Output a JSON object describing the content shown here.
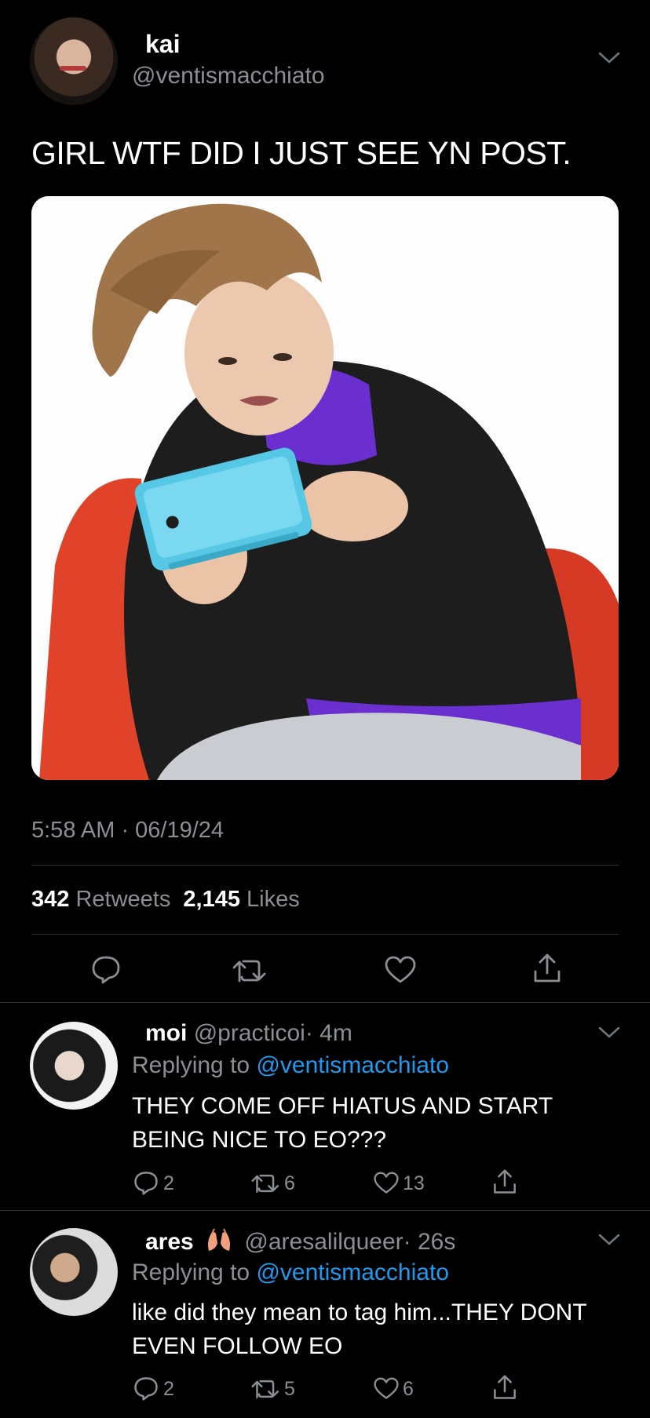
{
  "main_tweet": {
    "author_name": "kai",
    "author_handle": "@ventismacchiato",
    "text": "GIRL WTF DID I JUST SEE YN POST.",
    "timestamp": "5:58 AM · 06/19/24",
    "retweets_count": "342",
    "retweets_label": "Retweets",
    "likes_count": "2,145",
    "likes_label": "Likes"
  },
  "replies": [
    {
      "author_name": "moi",
      "author_handle": "@practicoi",
      "time": "· 4m",
      "replying_prefix": "Replying to",
      "replying_to": "@ventismacchiato",
      "text": "THEY COME OFF HIATUS AND START BEING NICE TO EO???",
      "reply_count": "2",
      "retweet_count": "6",
      "like_count": "13"
    },
    {
      "author_name": "ares",
      "author_handle": "@aresalilqueer",
      "time": "· 26s",
      "replying_prefix": "Replying to",
      "replying_to": "@ventismacchiato",
      "text": "like did they mean to tag him...THEY DONT EVEN FOLLOW EO",
      "reply_count": "2",
      "retweet_count": "5",
      "like_count": "6"
    }
  ],
  "icons": [
    "chevron-down-icon",
    "reply-icon",
    "retweet-icon",
    "like-icon",
    "share-icon",
    "hands-emoji-icon"
  ],
  "colors": {
    "background": "#000000",
    "text": "#ffffff",
    "muted": "#8b8f94",
    "link": "#1d9bf0",
    "divider": "#2f3336"
  }
}
